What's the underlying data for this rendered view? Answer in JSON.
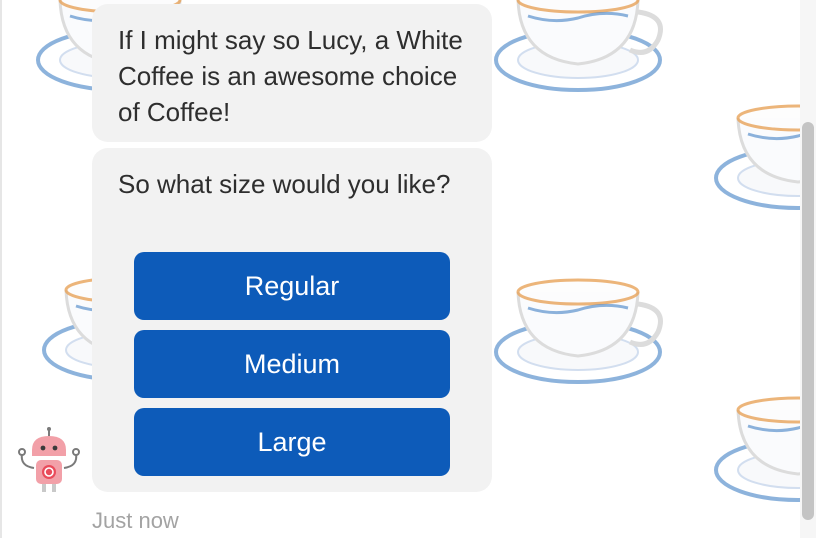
{
  "messages": [
    {
      "text": "If I might say so Lucy, a White Coffee is an awesome choice of Coffee!"
    },
    {
      "text": "So what size would you like?"
    }
  ],
  "options": [
    {
      "label": "Regular"
    },
    {
      "label": "Medium"
    },
    {
      "label": "Large"
    }
  ],
  "timestamp": "Just now",
  "icons": {
    "avatar": "robot-avatar-icon",
    "background": "coffee-cup-icon"
  },
  "colors": {
    "button": "#0d5bb9",
    "bubble": "#f2f2f2",
    "timestamp": "#a3a3a3",
    "cup_rim": "#2f74c0",
    "cup_tea": "#e8a35a"
  }
}
